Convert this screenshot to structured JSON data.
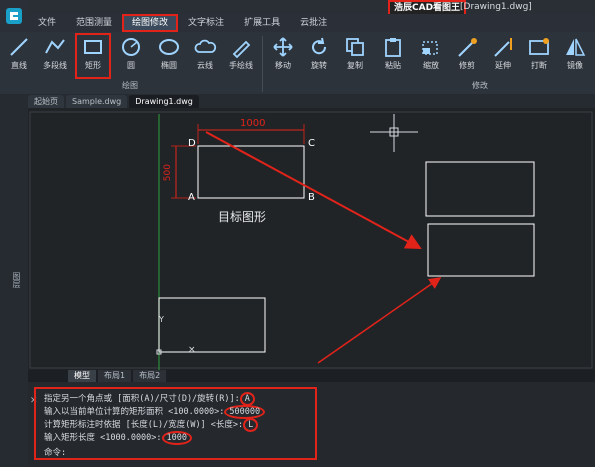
{
  "title": {
    "app_label": "浩辰CAD看图王",
    "document": "[Drawing1.dwg]"
  },
  "menu": {
    "tabs": [
      "文件",
      "范围测量",
      "绘图修改",
      "文字标注",
      "扩展工具",
      "云批注"
    ],
    "active": "绘图修改"
  },
  "ribbon": {
    "draw_tools": [
      "直线",
      "多段线",
      "矩形",
      "圆",
      "椭圆",
      "云线",
      "手绘线"
    ],
    "modify_tools": [
      "移动",
      "旋转",
      "复制",
      "粘贴",
      "缩放",
      "修剪",
      "延伸",
      "打断",
      "镜像"
    ],
    "draw_group_label": "绘图",
    "modify_group_label": "修改"
  },
  "doc_tabs": [
    "起始页",
    "Sample.dwg",
    "Drawing1.dwg"
  ],
  "left_panel_label": "图层",
  "canvas": {
    "dimension_width": "1000",
    "dimension_height": "500",
    "corner_a": "A",
    "corner_b": "B",
    "corner_c": "C",
    "corner_d": "D",
    "target_label": "目标图形"
  },
  "layout_tabs": [
    "模型",
    "布局1",
    "布局2"
  ],
  "command": {
    "lines": [
      {
        "text": "指定另一个角点或 [面积(A)/尺寸(D)/旋转(R)]:",
        "value": "A"
      },
      {
        "text": "输入以当前单位计算的矩形面积 <100.0000>:",
        "value": "500000"
      },
      {
        "text": "计算矩形标注时依据 [长度(L)/宽度(W)] <长度>:",
        "value": "L"
      },
      {
        "text": "输入矩形长度 <1000.0000>:",
        "value": "1000"
      }
    ],
    "prompt": "命令:"
  },
  "colors": {
    "accent_red": "#e2231a",
    "canvas_bg": "#212427",
    "drawing_white": "#ffffff"
  }
}
